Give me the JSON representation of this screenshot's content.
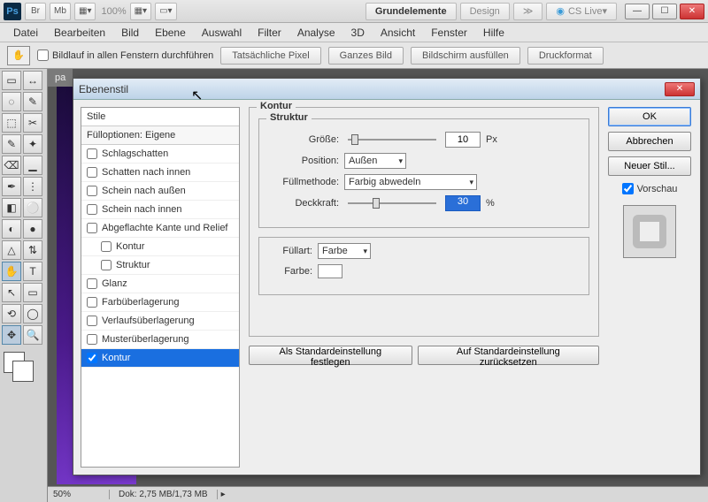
{
  "titlebar": {
    "zoom": "100%",
    "workspace_tabs": [
      "Grundelemente",
      "Design"
    ],
    "cslive": "CS Live"
  },
  "menus": [
    "Datei",
    "Bearbeiten",
    "Bild",
    "Ebene",
    "Auswahl",
    "Filter",
    "Analyse",
    "3D",
    "Ansicht",
    "Fenster",
    "Hilfe"
  ],
  "optbar": {
    "scroll_label": "Bildlauf in allen Fenstern durchführen",
    "buttons": [
      "Tatsächliche Pixel",
      "Ganzes Bild",
      "Bildschirm ausfüllen",
      "Druckformat"
    ]
  },
  "doc_tab": "pa",
  "status": {
    "zoom": "50%",
    "dok": "Dok: 2,75 MB/1,73 MB"
  },
  "dialog": {
    "title": "Ebenenstil",
    "styles_header": "Stile",
    "fill_opts": "Fülloptionen: Eigene",
    "items": [
      {
        "label": "Schlagschatten",
        "checked": false
      },
      {
        "label": "Schatten nach innen",
        "checked": false
      },
      {
        "label": "Schein nach außen",
        "checked": false
      },
      {
        "label": "Schein nach innen",
        "checked": false
      },
      {
        "label": "Abgeflachte Kante und Relief",
        "checked": false
      },
      {
        "label": "Kontur",
        "checked": false,
        "indent": true
      },
      {
        "label": "Struktur",
        "checked": false,
        "indent": true
      },
      {
        "label": "Glanz",
        "checked": false
      },
      {
        "label": "Farbüberlagerung",
        "checked": false
      },
      {
        "label": "Verlaufsüberlagerung",
        "checked": false
      },
      {
        "label": "Musterüberlagerung",
        "checked": false
      },
      {
        "label": "Kontur",
        "checked": true,
        "selected": true
      }
    ],
    "panel": {
      "outer_title": "Kontur",
      "struct_title": "Struktur",
      "size_label": "Größe:",
      "size_value": "10",
      "size_unit": "Px",
      "position_label": "Position:",
      "position_value": "Außen",
      "blend_label": "Füllmethode:",
      "blend_value": "Farbig abwedeln",
      "opacity_label": "Deckkraft:",
      "opacity_value": "30",
      "opacity_unit": "%",
      "filltype_label": "Füllart:",
      "filltype_value": "Farbe",
      "color_label": "Farbe:",
      "default_set": "Als Standardeinstellung festlegen",
      "default_reset": "Auf Standardeinstellung zurücksetzen"
    },
    "right": {
      "ok": "OK",
      "cancel": "Abbrechen",
      "new_style": "Neuer Stil...",
      "preview": "Vorschau"
    }
  },
  "tool_glyphs": [
    "▭",
    "↔",
    "◌",
    "✎",
    "⬚",
    "✂",
    "✎",
    "✦",
    "⌫",
    "▁",
    "✒",
    "⋮",
    "◧",
    "⚪",
    "◐",
    "●",
    "△",
    "⇅",
    "✋",
    "T",
    "↖",
    "▭",
    "⟲",
    "◯",
    "✥",
    "🔍"
  ]
}
